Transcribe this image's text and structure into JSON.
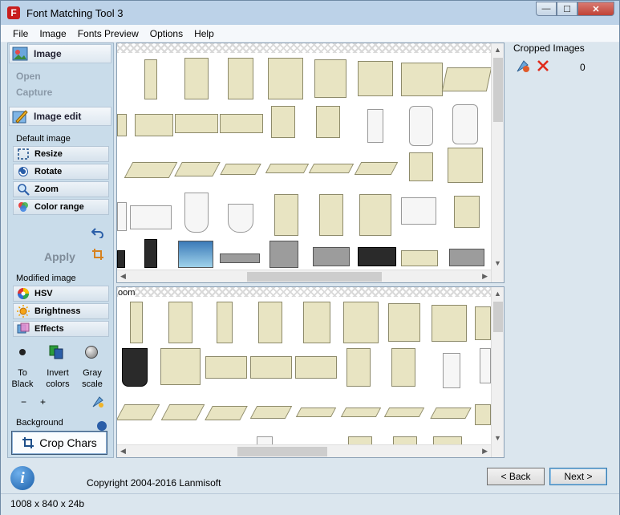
{
  "window": {
    "title": "Font Matching Tool 3",
    "app_icon_glyph": "F",
    "controls": {
      "minimize": "—",
      "maximize": "☐",
      "close": "✕"
    }
  },
  "menu": [
    "File",
    "Image",
    "Fonts Preview",
    "Options",
    "Help"
  ],
  "left_panel": {
    "image_section": {
      "title": "Image",
      "items": [
        "Open",
        "Capture"
      ]
    },
    "edit_section": {
      "title": "Image edit",
      "default_label": "Default image",
      "default_tools": [
        "Resize",
        "Rotate",
        "Zoom",
        "Color range"
      ],
      "apply_label": "Apply",
      "modified_label": "Modified image",
      "modified_tools": [
        "HSV",
        "Brightness",
        "Effects"
      ],
      "color_ops": [
        {
          "line1": "To",
          "line2": "Black"
        },
        {
          "line1": "Invert",
          "line2": "colors"
        },
        {
          "line1": "Gray",
          "line2": "scale"
        }
      ],
      "minus": "−",
      "plus": "+",
      "background_label": "Background"
    },
    "crop_button": "Crop Chars"
  },
  "image_panes": {
    "bottom_zoom_label": "oom"
  },
  "right_panel": {
    "title": "Cropped Images",
    "count": "0"
  },
  "footer": {
    "copyright": "Copyright 2004-2016 Lanmisoft",
    "back": "< Back",
    "next": "Next >",
    "status": "1008 x 840 x 24b"
  }
}
